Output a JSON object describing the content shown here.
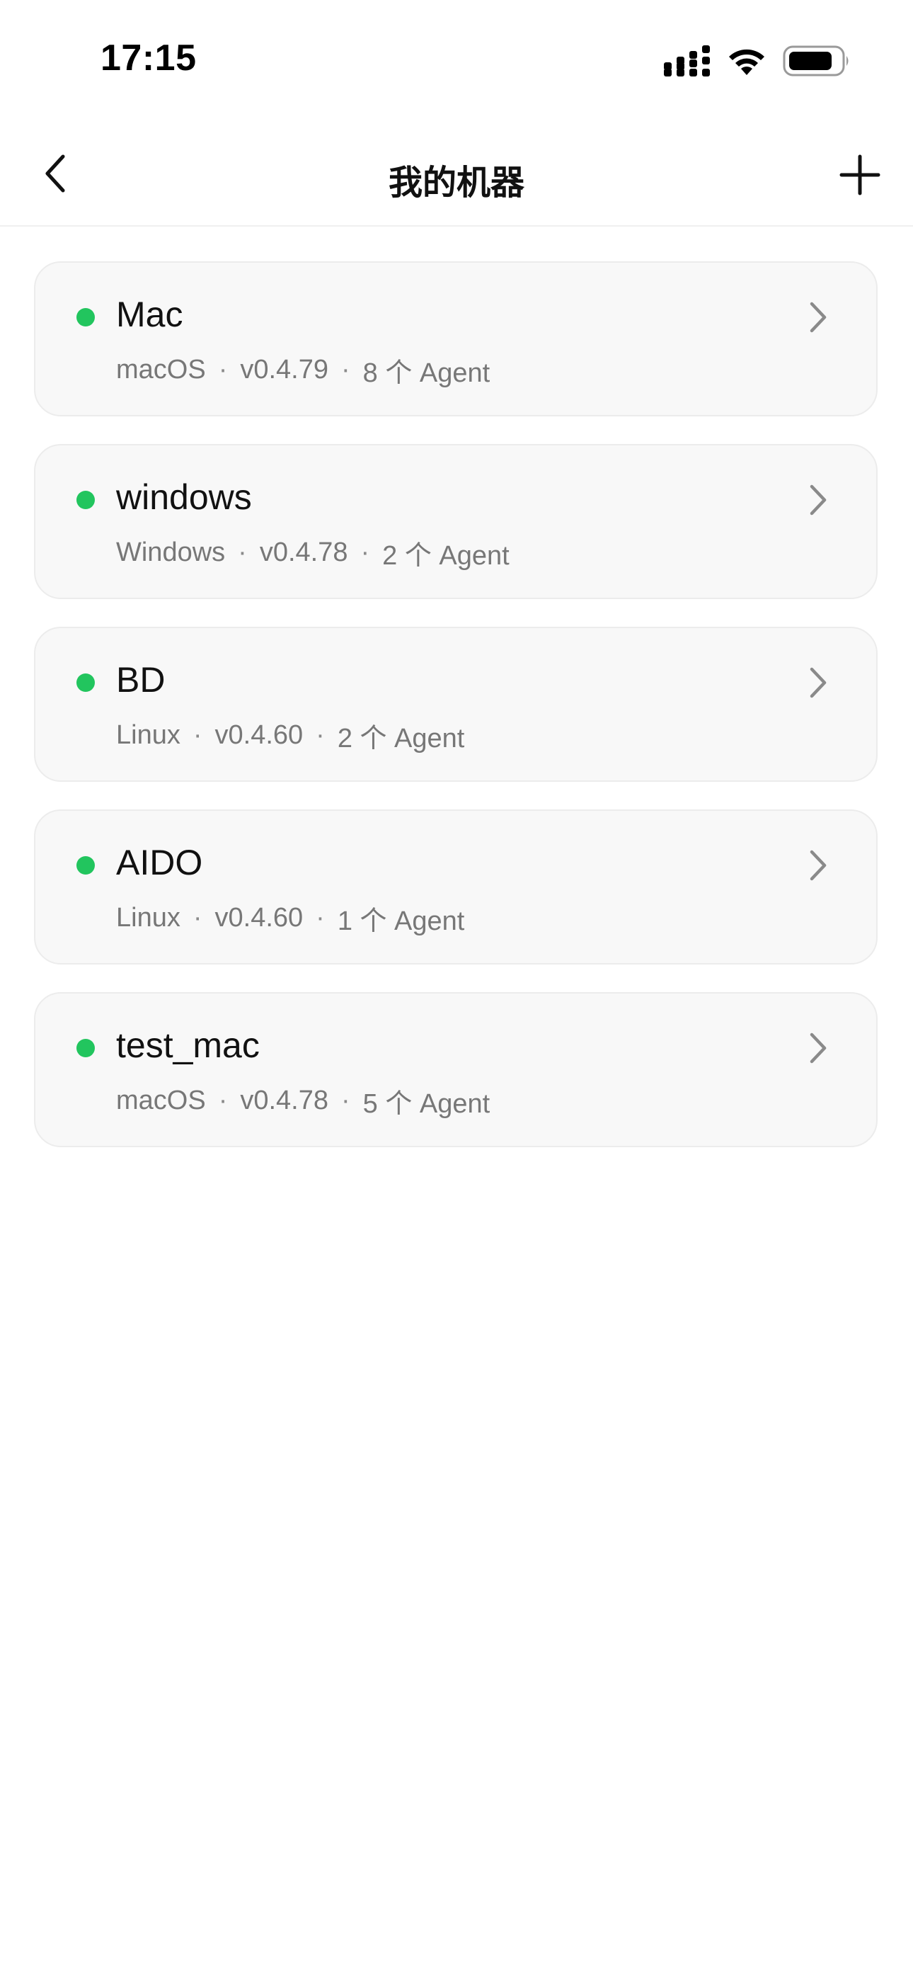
{
  "status_bar": {
    "time": "17:15",
    "icons": [
      "cellular-signal-icon",
      "wifi-icon",
      "battery-icon"
    ]
  },
  "nav": {
    "title": "我的机器",
    "back_icon": "chevron-left-icon",
    "add_icon": "plus-icon"
  },
  "colors": {
    "online": "#22c55e",
    "card_bg": "#f8f8f8",
    "card_border": "#ececec",
    "meta_text": "#777777"
  },
  "separator": "·",
  "machines": [
    {
      "name": "Mac",
      "os": "macOS",
      "version": "v0.4.79",
      "agents": "8 个 Agent",
      "status": "online"
    },
    {
      "name": "windows",
      "os": "Windows",
      "version": "v0.4.78",
      "agents": "2 个 Agent",
      "status": "online"
    },
    {
      "name": "BD",
      "os": "Linux",
      "version": "v0.4.60",
      "agents": "2 个 Agent",
      "status": "online"
    },
    {
      "name": "AIDO",
      "os": "Linux",
      "version": "v0.4.60",
      "agents": "1 个 Agent",
      "status": "online"
    },
    {
      "name": "test_mac",
      "os": "macOS",
      "version": "v0.4.78",
      "agents": "5 个 Agent",
      "status": "online"
    }
  ]
}
